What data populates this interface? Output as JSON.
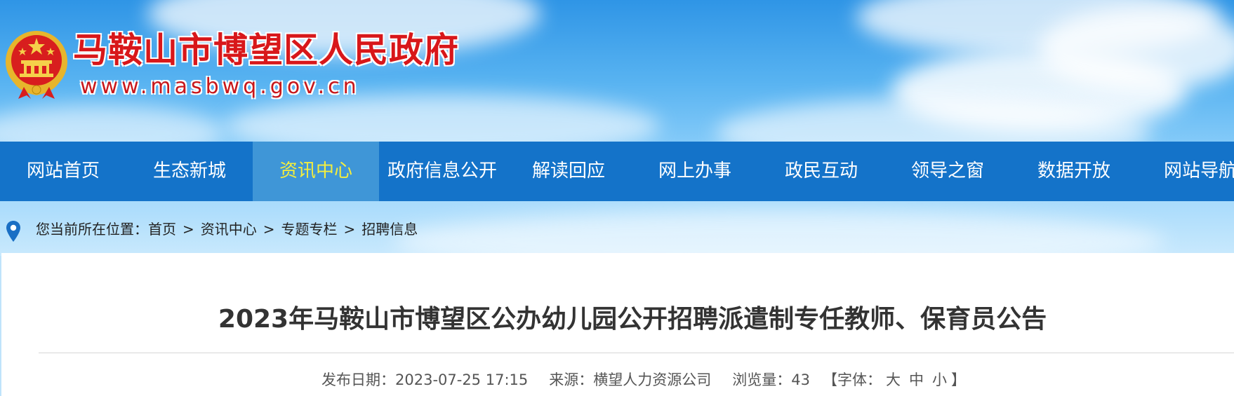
{
  "header": {
    "site_title": "马鞍山市博望区人民政府",
    "site_url": "www.masbwq.gov.cn"
  },
  "nav": {
    "items": [
      {
        "label": "网站首页",
        "active": false
      },
      {
        "label": "生态新城",
        "active": false
      },
      {
        "label": "资讯中心",
        "active": true
      },
      {
        "label": "政府信息公开",
        "active": false
      },
      {
        "label": "解读回应",
        "active": false
      },
      {
        "label": "网上办事",
        "active": false
      },
      {
        "label": "政民互动",
        "active": false
      },
      {
        "label": "领导之窗",
        "active": false
      },
      {
        "label": "数据开放",
        "active": false
      },
      {
        "label": "网站导航",
        "active": false
      }
    ]
  },
  "breadcrumb": {
    "prefix": "您当前所在位置：",
    "items": [
      "首页",
      "资讯中心",
      "专题专栏",
      "招聘信息"
    ],
    "separator": ">"
  },
  "article": {
    "title": "2023年马鞍山市博望区公办幼儿园公开招聘派遣制专任教师、保育员公告",
    "date_label": "发布日期：",
    "date": "2023-07-25 17:15",
    "source_label": "来源：",
    "source": "横望人力资源公司",
    "views_label": "浏览量：",
    "views": "43",
    "font_open": "【字体：",
    "font_large": "大",
    "font_medium": "中",
    "font_small": "小",
    "font_close": "】"
  },
  "colors": {
    "nav_bg": "#1473c9",
    "nav_active_bg": "#3f96d7",
    "nav_active_text": "#f4ee3d",
    "title_red": "#d8171a"
  },
  "icons": {
    "emblem": "national-emblem-icon",
    "location": "location-pin-icon"
  }
}
